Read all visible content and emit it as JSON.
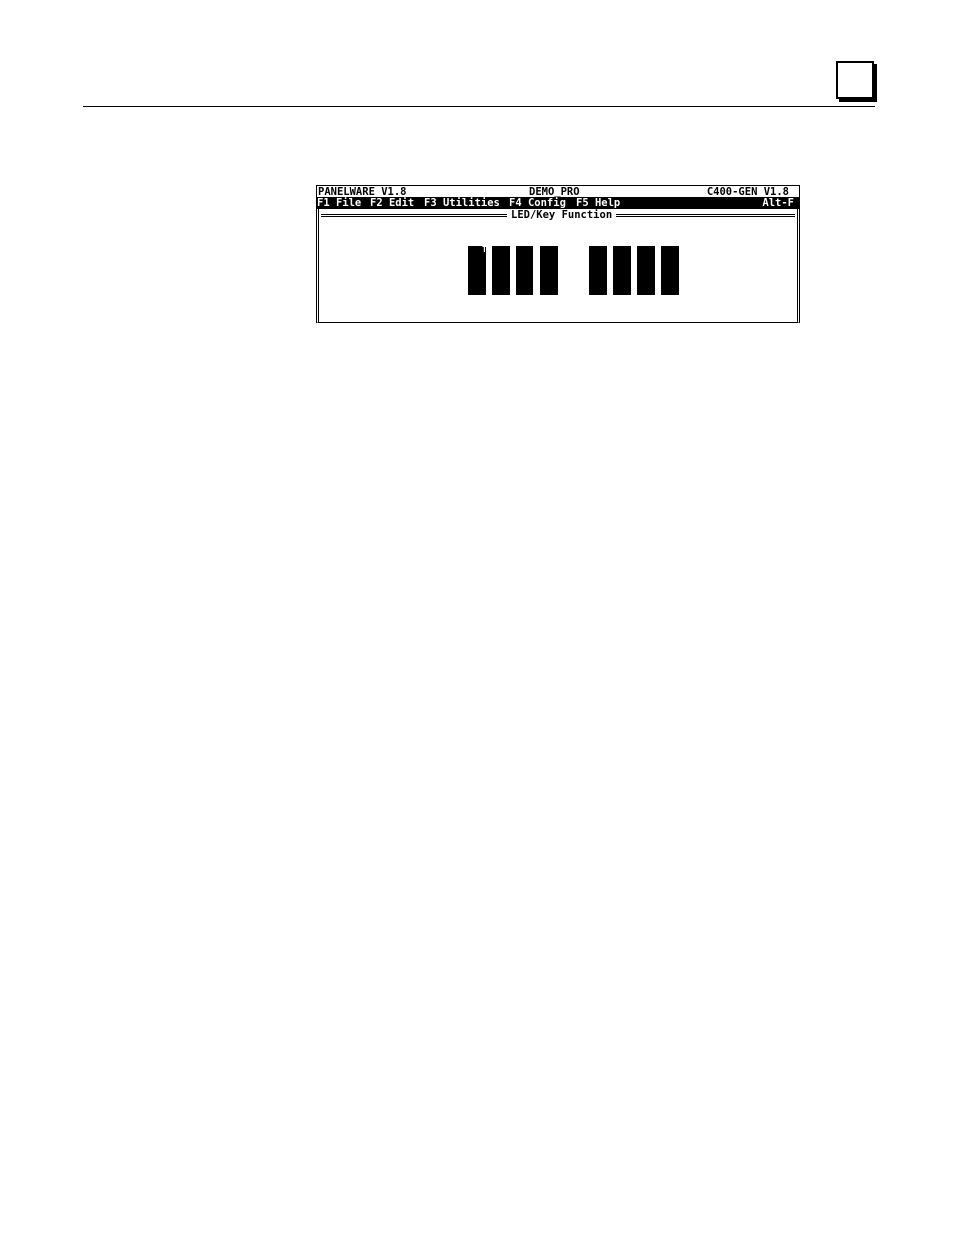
{
  "screen": {
    "title_left": "PANELWARE V1.8",
    "title_center": "DEMO_PRO",
    "title_right": "C400-GEN V1.8",
    "menu": [
      {
        "label": "F1 File"
      },
      {
        "label": "F2 Edit"
      },
      {
        "label": "F3 Utilities"
      },
      {
        "label": "F4 Config"
      },
      {
        "label": "F5 Help"
      }
    ],
    "menu_shortcut": "Alt-F",
    "panel_title": "LED/Key Function",
    "led_marker": "T",
    "led_group_left_count": 4,
    "led_group_right_count": 4
  },
  "colors": {
    "foreground": "#000000",
    "background": "#ffffff"
  }
}
